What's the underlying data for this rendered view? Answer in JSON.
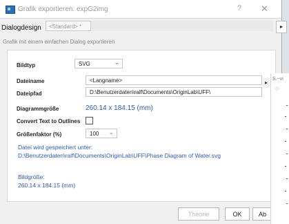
{
  "window": {
    "title": "Grafik exportieren: expG2img",
    "help_glyph": "?",
    "close_glyph": "✕"
  },
  "dialog_design": {
    "label": "Dialogdesign",
    "value": "<Standard> *",
    "expand_glyph": "▸"
  },
  "subtitle": "Grafik mit einem einfachen Dialog exportieren",
  "form": {
    "image_type": {
      "label": "Bildtyp",
      "value": "SVG"
    },
    "filename": {
      "label": "Dateiname",
      "value": "<Langname>"
    },
    "filepath": {
      "label": "Dateipfad",
      "value": "D:\\Benutzerdaten\\ralf\\Documents\\OriginLab\\UFF\\"
    },
    "diagram_size": {
      "label": "Diagrammgröße",
      "value": "260.14 x 184.15 (mm)"
    },
    "convert_text": {
      "label": "Convert Text to Outlines",
      "checked": false
    },
    "scale_factor": {
      "label": "Größenfaktor (%)",
      "value": "100"
    },
    "save_note": {
      "line1": "Datei wird gespeichert unter:",
      "line2": "D:\\Benutzerdaten\\ralf\\Documents\\OriginLab\\UFF\\Phase Diagram of Water.svg"
    },
    "image_size": {
      "label": "Bildgröße:",
      "value": "260.14 x 184.15 (mm)"
    }
  },
  "side_panel": {
    "button_glyph": "▸",
    "header": "S.~vi",
    "diamond": "◇"
  },
  "buttons": {
    "preview": "Theorie",
    "ok": "OK",
    "cancel": "Ab"
  },
  "colors": {
    "accent_blue": "#2d5ab3",
    "label_text": "#222222"
  }
}
